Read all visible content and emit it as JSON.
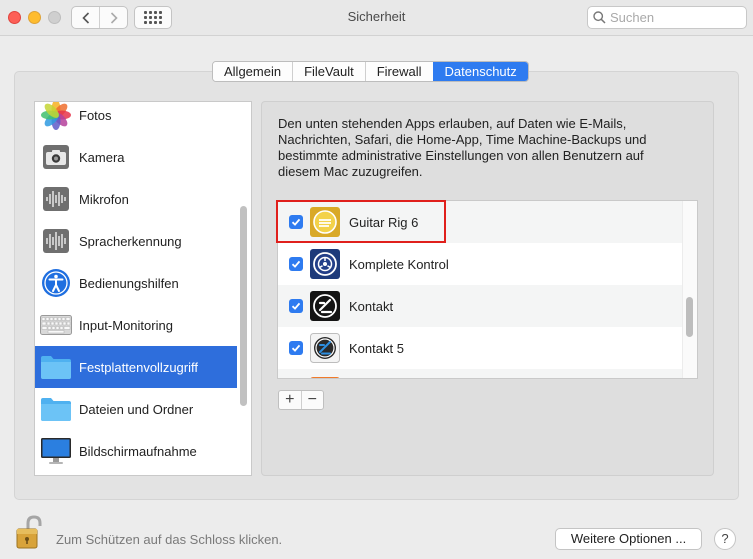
{
  "window": {
    "title": "Sicherheit"
  },
  "search": {
    "placeholder": "Suchen"
  },
  "tabs": [
    {
      "label": "Allgemein"
    },
    {
      "label": "FileVault"
    },
    {
      "label": "Firewall"
    },
    {
      "label": "Datenschutz",
      "selected": true
    }
  ],
  "sidebar": {
    "items": [
      {
        "label": "Fotos",
        "icon": "photos-icon"
      },
      {
        "label": "Kamera",
        "icon": "camera-icon"
      },
      {
        "label": "Mikrofon",
        "icon": "microphone-icon"
      },
      {
        "label": "Spracherkennung",
        "icon": "speech-recognition-icon"
      },
      {
        "label": "Bedienungshilfen",
        "icon": "accessibility-icon"
      },
      {
        "label": "Input-Monitoring",
        "icon": "keyboard-icon"
      },
      {
        "label": "Festplattenvollzugriff",
        "icon": "folder-icon",
        "selected": true
      },
      {
        "label": "Dateien und Ordner",
        "icon": "folder-icon"
      },
      {
        "label": "Bildschirmaufnahme",
        "icon": "display-icon"
      }
    ]
  },
  "main": {
    "description": "Den unten stehenden Apps erlauben, auf Daten wie E-Mails, Nachrichten, Safari, die Home-App, Time Machine-Backups und bestimmte administrative Einstellungen von allen Benutzern auf diesem Mac zuzugreifen.",
    "apps": [
      {
        "name": "Guitar Rig 6",
        "checked": true,
        "icon": "guitar-rig-icon"
      },
      {
        "name": "Komplete Kontrol",
        "checked": true,
        "icon": "komplete-kontrol-icon"
      },
      {
        "name": "Kontakt",
        "checked": true,
        "icon": "kontakt-icon"
      },
      {
        "name": "Kontakt 5",
        "checked": true,
        "icon": "kontakt-5-icon"
      }
    ],
    "add_label": "+",
    "remove_label": "−"
  },
  "footer": {
    "lock_text": "Zum Schützen auf das Schloss klicken.",
    "more_button": "Weitere Optionen ...",
    "help_button": "?"
  },
  "colors": {
    "accent": "#2e7bf0",
    "selection": "#2e6edc",
    "highlight_border": "#e0201c"
  }
}
